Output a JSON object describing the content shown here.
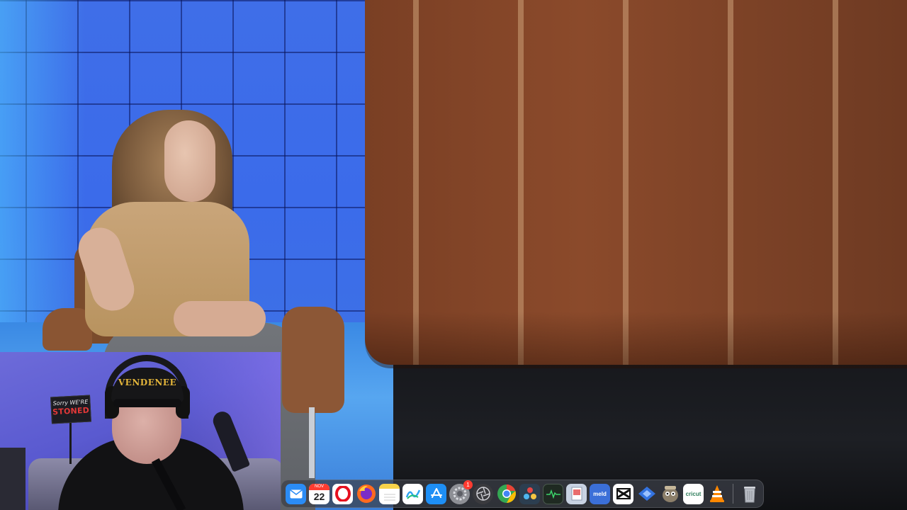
{
  "webcam": {
    "sign_line1": "Sorry WE'RE",
    "sign_line2": "STONED",
    "cap_text": "VENDENEE"
  },
  "dock": {
    "items": [
      {
        "name": "Mail",
        "icon": "mail-icon",
        "color": "#2b8cf5"
      },
      {
        "name": "Calendar",
        "icon": "calendar-icon",
        "month": "NOV",
        "day": "22"
      },
      {
        "name": "Opera",
        "icon": "opera-icon",
        "color": "#e6101f"
      },
      {
        "name": "Firefox",
        "icon": "firefox-icon",
        "color": "#ff6a1f"
      },
      {
        "name": "Notes",
        "icon": "notes-icon",
        "color": "#f8d34a"
      },
      {
        "name": "Freeform",
        "icon": "freeform-icon",
        "color": "#2fa3f2"
      },
      {
        "name": "App Store",
        "icon": "app-store-icon",
        "color": "#1e8ff5"
      },
      {
        "name": "System Settings",
        "icon": "settings-icon",
        "color": "#8d8f95",
        "badge": "1"
      },
      {
        "name": "Camera Aperture",
        "icon": "aperture-icon",
        "color": "#3a3a3e"
      },
      {
        "name": "Chrome",
        "icon": "chrome-icon",
        "color": "#34a853"
      },
      {
        "name": "DaVinci Resolve",
        "icon": "davinci-icon",
        "color": "#2c3e50"
      },
      {
        "name": "Activity Monitor",
        "icon": "activity-monitor-icon",
        "color": "#1f2a22"
      },
      {
        "name": "Preview",
        "icon": "preview-icon",
        "color": "#c8d2e2"
      },
      {
        "name": "Meld",
        "icon": "meld-icon",
        "color": "#3b6fd8",
        "label": "meld"
      },
      {
        "name": "CapCut",
        "icon": "capcut-icon",
        "color": "#ffffff"
      },
      {
        "name": "Network",
        "icon": "network-icon",
        "color": "#3473e0"
      },
      {
        "name": "GIMP",
        "icon": "gimp-icon",
        "color": "#8c7f6a"
      },
      {
        "name": "Cricut",
        "icon": "cricut-icon",
        "color": "#ffffff",
        "label": "cricut"
      },
      {
        "name": "VLC",
        "icon": "vlc-icon",
        "color": "#ff8800"
      },
      {
        "name": "Trash",
        "icon": "trash-icon",
        "color": "#b8bcc4"
      }
    ]
  }
}
